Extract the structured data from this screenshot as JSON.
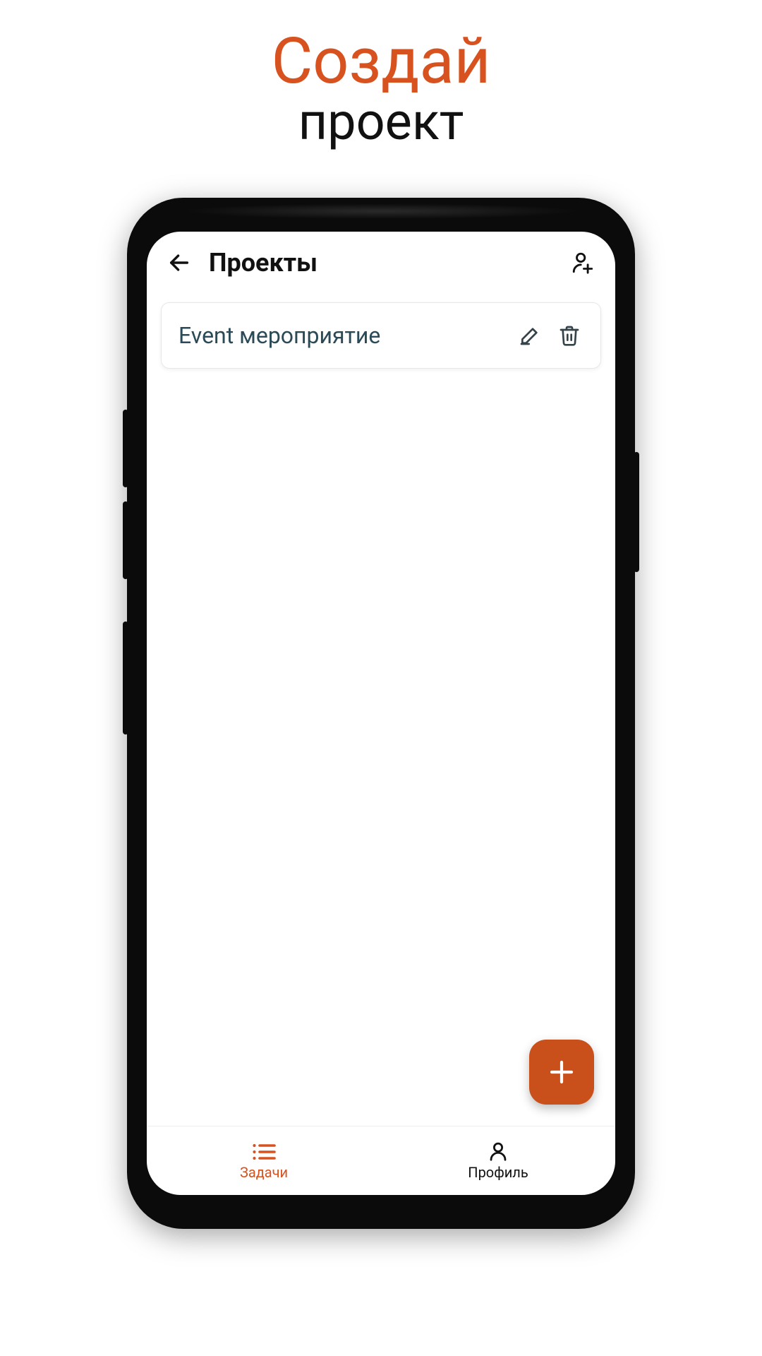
{
  "hero": {
    "line1": "Создай",
    "line2": "проект"
  },
  "header": {
    "title": "Проекты"
  },
  "projects": {
    "items": [
      {
        "name": "Event мероприятие"
      }
    ]
  },
  "nav": {
    "tasks_label": "Задачи",
    "profile_label": "Профиль"
  },
  "colors": {
    "accent": "#d8521f",
    "fab": "#c9501b",
    "card_text": "#2b4a58",
    "icon": "#344349"
  }
}
